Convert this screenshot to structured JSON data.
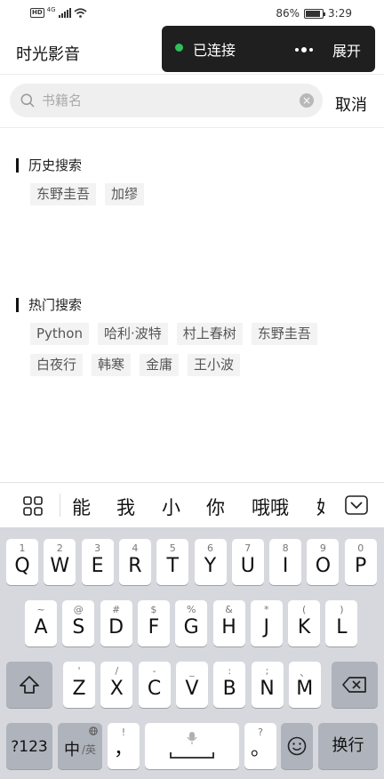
{
  "status_bar": {
    "network_badge": "HD",
    "signal_label": "4G",
    "battery_percent_text": "86%",
    "battery_level": 0.86,
    "time": "3:29"
  },
  "header": {
    "app_title": "时光影音",
    "connection": {
      "status_text": "已连接",
      "status_color": "#2ec05a",
      "expand_label": "展开"
    }
  },
  "search": {
    "placeholder": "书籍名",
    "cancel_label": "取消"
  },
  "history": {
    "title": "历史搜索",
    "tags": [
      "东野圭吾",
      "加缪"
    ]
  },
  "hot": {
    "title": "热门搜索",
    "tags_row1": [
      "Python",
      "哈利·波特",
      "村上春树",
      "东野圭吾"
    ],
    "tags_row2": [
      "白夜行",
      "韩寒",
      "金庸",
      "王小波"
    ]
  },
  "ime": {
    "candidates": [
      "能",
      "我",
      "小",
      "你",
      "哦哦",
      "好"
    ],
    "row1": [
      {
        "sub": "1",
        "main": "Q"
      },
      {
        "sub": "2",
        "main": "W"
      },
      {
        "sub": "3",
        "main": "E"
      },
      {
        "sub": "4",
        "main": "R"
      },
      {
        "sub": "5",
        "main": "T"
      },
      {
        "sub": "6",
        "main": "Y"
      },
      {
        "sub": "7",
        "main": "U"
      },
      {
        "sub": "8",
        "main": "I"
      },
      {
        "sub": "9",
        "main": "O"
      },
      {
        "sub": "0",
        "main": "P"
      }
    ],
    "row2": [
      {
        "sub": "~",
        "main": "A"
      },
      {
        "sub": "@",
        "main": "S"
      },
      {
        "sub": "#",
        "main": "D"
      },
      {
        "sub": "$",
        "main": "F"
      },
      {
        "sub": "%",
        "main": "G"
      },
      {
        "sub": "&",
        "main": "H"
      },
      {
        "sub": "*",
        "main": "J"
      },
      {
        "sub": "(",
        "main": "K"
      },
      {
        "sub": ")",
        "main": "L"
      }
    ],
    "row3": [
      {
        "sub": "'",
        "main": "Z"
      },
      {
        "sub": "/",
        "main": "X"
      },
      {
        "sub": "-",
        "main": "C"
      },
      {
        "sub": "_",
        "main": "V"
      },
      {
        "sub": ":",
        "main": "B"
      },
      {
        "sub": ";",
        "main": "N"
      },
      {
        "sub": "、",
        "main": "M"
      }
    ],
    "num_key": "?123",
    "lang_key_main": "中",
    "lang_key_sub": "/英",
    "comma_sub": "!",
    "comma_main": "，",
    "period_sub": "?",
    "period_main": "。",
    "enter_label": "换行"
  }
}
